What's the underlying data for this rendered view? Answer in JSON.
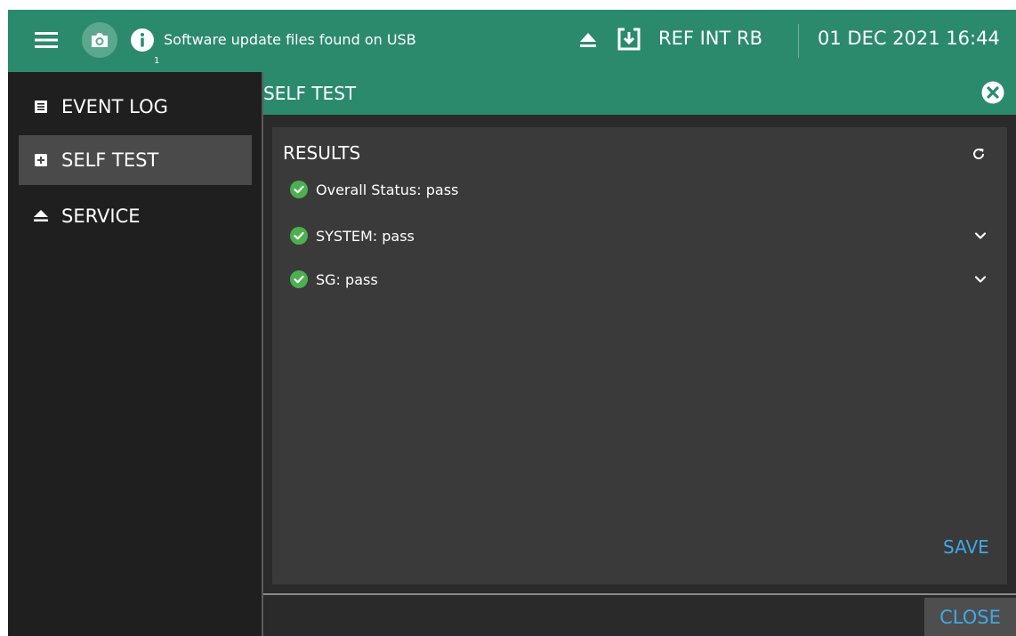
{
  "topbar": {
    "notification_count": "1",
    "notification_text": "Software update files found on USB",
    "reference": "REF INT RB",
    "datetime": "01 DEC 2021 16:44",
    "icons": [
      "menu-icon",
      "camera-icon",
      "info-icon",
      "eject-icon",
      "download-icon"
    ],
    "accent_color": "#2b8a6c"
  },
  "sidebar": {
    "items": [
      {
        "label": "EVENT LOG",
        "icon": "list-icon",
        "active": false
      },
      {
        "label": "SELF TEST",
        "icon": "plus-box-icon",
        "active": true
      },
      {
        "label": "SERVICE",
        "icon": "eject-icon",
        "active": false
      }
    ]
  },
  "panel": {
    "title": "SELF TEST",
    "results_title": "RESULTS",
    "rows": [
      {
        "label": "Overall Status: pass",
        "status": "pass",
        "expandable": false
      },
      {
        "label": "SYSTEM: pass",
        "status": "pass",
        "expandable": true
      },
      {
        "label": "SG: pass",
        "status": "pass",
        "expandable": true
      }
    ],
    "save_label": "SAVE",
    "close_label": "CLOSE",
    "pass_color": "#4caf50",
    "link_color": "#3fa9e6"
  }
}
